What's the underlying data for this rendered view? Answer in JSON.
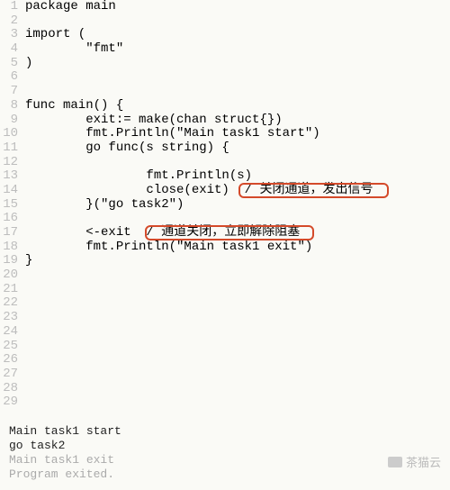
{
  "code": {
    "lines": [
      "package main",
      "",
      "import (",
      "        \"fmt\"",
      ")",
      "",
      "",
      "func main() {",
      "        exit:= make(chan struct{})",
      "        fmt.Println(\"Main task1 start\")",
      "        go func(s string) {",
      "",
      "                fmt.Println(s)",
      "                close(exit)  / 关闭通道，发出信号",
      "        }(\"go task2\")",
      "",
      "        <-exit  / 通道关闭，立即解除阻塞",
      "        fmt.Println(\"Main task1 exit\")",
      "}",
      "",
      "",
      "",
      "",
      "",
      "",
      "",
      "",
      "",
      ""
    ],
    "line_numbers": [
      "1",
      "2",
      "3",
      "4",
      "5",
      "6",
      "7",
      "8",
      "9",
      "10",
      "11",
      "12",
      "13",
      "14",
      "15",
      "16",
      "17",
      "18",
      "19",
      "20",
      "21",
      "22",
      "23",
      "24",
      "25",
      "26",
      "27",
      "28",
      "29"
    ],
    "annotation1": "/ 关闭通道，发出信号",
    "annotation2": "/ 通道关闭，立即解除阻塞"
  },
  "output": {
    "line1": "Main task1 start",
    "line2": "go task2",
    "line3": "Main task1 exit",
    "line4": "",
    "line5": "Program exited."
  },
  "watermark": "茶猫云"
}
